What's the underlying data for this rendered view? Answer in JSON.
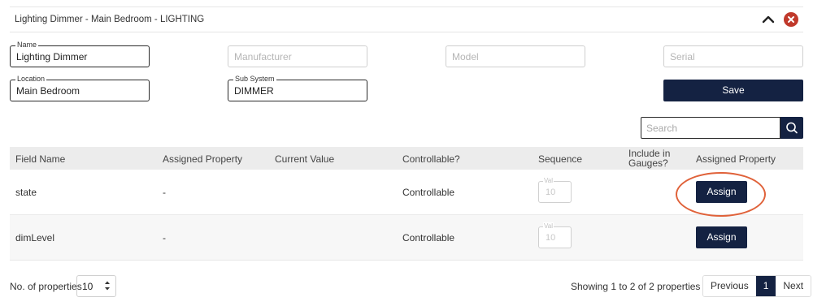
{
  "panel": {
    "title": "Lighting Dimmer - Main Bedroom - LIGHTING"
  },
  "form": {
    "name": {
      "label": "Name",
      "value": "Lighting Dimmer"
    },
    "manufacturer": {
      "placeholder": "Manufacturer"
    },
    "model": {
      "placeholder": "Model"
    },
    "serial": {
      "placeholder": "Serial"
    },
    "location": {
      "label": "Location",
      "value": "Main Bedroom"
    },
    "subsystem": {
      "label": "Sub System",
      "value": "DIMMER"
    },
    "save_label": "Save"
  },
  "search": {
    "placeholder": "Search"
  },
  "table": {
    "columns": [
      "Field Name",
      "Assigned Property",
      "Current Value",
      "Controllable?",
      "Sequence",
      "Include in Gauges?",
      "Assigned Property"
    ],
    "rows": [
      {
        "field_name": "state",
        "assigned_property": "-",
        "current_value": "",
        "controllable": "Controllable",
        "sequence_label": "Val",
        "sequence_placeholder": "10",
        "action": "Assign"
      },
      {
        "field_name": "dimLevel",
        "assigned_property": "-",
        "current_value": "",
        "controllable": "Controllable",
        "sequence_label": "Val",
        "sequence_placeholder": "10",
        "action": "Assign"
      }
    ]
  },
  "footer": {
    "page_size_label": "No. of properties",
    "page_size_value": "10",
    "showing_text": "Showing 1 to 2 of 2 properties",
    "pagination": {
      "previous": "Previous",
      "current": "1",
      "next": "Next"
    }
  },
  "colors": {
    "primary": "#142242",
    "danger": "#c0392b",
    "highlight": "#e0623a"
  }
}
